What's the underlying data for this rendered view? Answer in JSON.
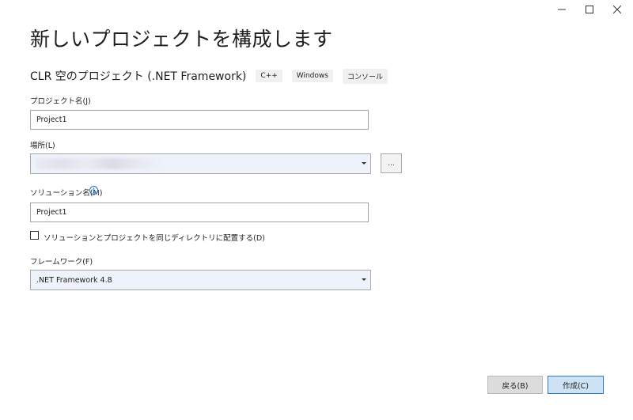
{
  "window": {
    "controls": [
      "minimize-icon",
      "maximize-icon",
      "close-icon"
    ]
  },
  "page_title": "新しいプロジェクトを構成します",
  "template": {
    "name": "CLR 空のプロジェクト (.NET Framework)",
    "tags": [
      "C++",
      "Windows",
      "コンソール"
    ]
  },
  "form": {
    "project_name_label": "プロジェクト名(J)",
    "project_name_value": "Project1",
    "location_label": "場所(L)",
    "browse_label": "...",
    "solution_name_label": "ソリューション名(M)",
    "solution_name_value": "Project1",
    "same_dir_checkbox_label": "ソリューションとプロジェクトを同じディレクトリに配置する(D)",
    "same_dir_checked": false,
    "framework_label": "フレームワーク(F)",
    "framework_value": ".NET Framework 4.8"
  },
  "buttons": {
    "back": "戻る(B)",
    "create": "作成(C)"
  },
  "colors": {
    "primary_button_bg": "#cde3f5",
    "primary_button_border": "#2e7cc7",
    "info_icon": "#1f6fc5"
  }
}
